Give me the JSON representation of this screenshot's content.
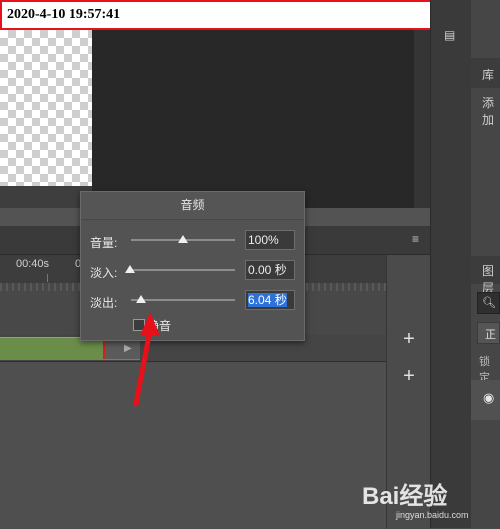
{
  "timestamp": "2020-4-10 19:57:41",
  "timeline": {
    "ruler_labels": [
      "00:40s",
      "0"
    ],
    "add_buttons": [
      "+",
      "+"
    ]
  },
  "right_panel": {
    "library_label": "库",
    "add_label": "添加",
    "layers_label": "图层",
    "search_icon": "search-icon",
    "normal_label": "正",
    "lock_label": "锁定",
    "eye_icon": "eye-icon"
  },
  "audio_panel": {
    "title": "音频",
    "volume": {
      "label": "音量:",
      "value": "100%",
      "level": 1.0
    },
    "fade_in": {
      "label": "淡入:",
      "value": "0.00 秒",
      "level": 0.0
    },
    "fade_out": {
      "label": "淡出:",
      "value": "6.04 秒",
      "level": 0.1
    },
    "mute_label": "静音",
    "mute_checked": false
  },
  "watermark": {
    "text": "Bai经验",
    "sub": "jingyan.baidu.com"
  },
  "colors": {
    "annotation_red": "#e8101a",
    "clip_green": "#6a8e4a",
    "selection_blue": "#2e71d8"
  }
}
